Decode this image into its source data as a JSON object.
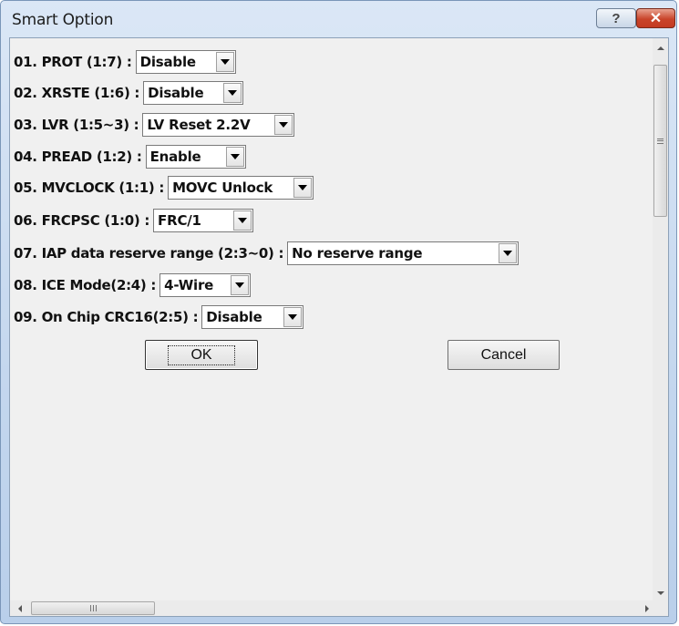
{
  "window": {
    "title": "Smart Option",
    "help_glyph": "?",
    "close_glyph": "✕"
  },
  "options": [
    {
      "label": "01. PROT (1:7) :",
      "value": "Disable"
    },
    {
      "label": "02. XRSTE (1:6) :",
      "value": "Disable"
    },
    {
      "label": "03. LVR (1:5~3) :",
      "value": "LV Reset 2.2V"
    },
    {
      "label": "04. PREAD (1:2) :",
      "value": "Enable"
    },
    {
      "label": "05. MVCLOCK (1:1) :",
      "value": "MOVC Unlock"
    },
    {
      "label": "06. FRCPSC (1:0) :",
      "value": "FRC/1"
    },
    {
      "label": "07. IAP data reserve range (2:3~0) :",
      "value": "No reserve range"
    },
    {
      "label": "08. ICE Mode(2:4) :",
      "value": "4-Wire"
    },
    {
      "label": "09. On Chip CRC16(2:5) :",
      "value": "Disable"
    }
  ],
  "buttons": {
    "ok": "OK",
    "cancel": "Cancel"
  },
  "icons": {
    "help": "help-icon",
    "close": "close-icon",
    "dropdown": "chevron-down-icon"
  }
}
